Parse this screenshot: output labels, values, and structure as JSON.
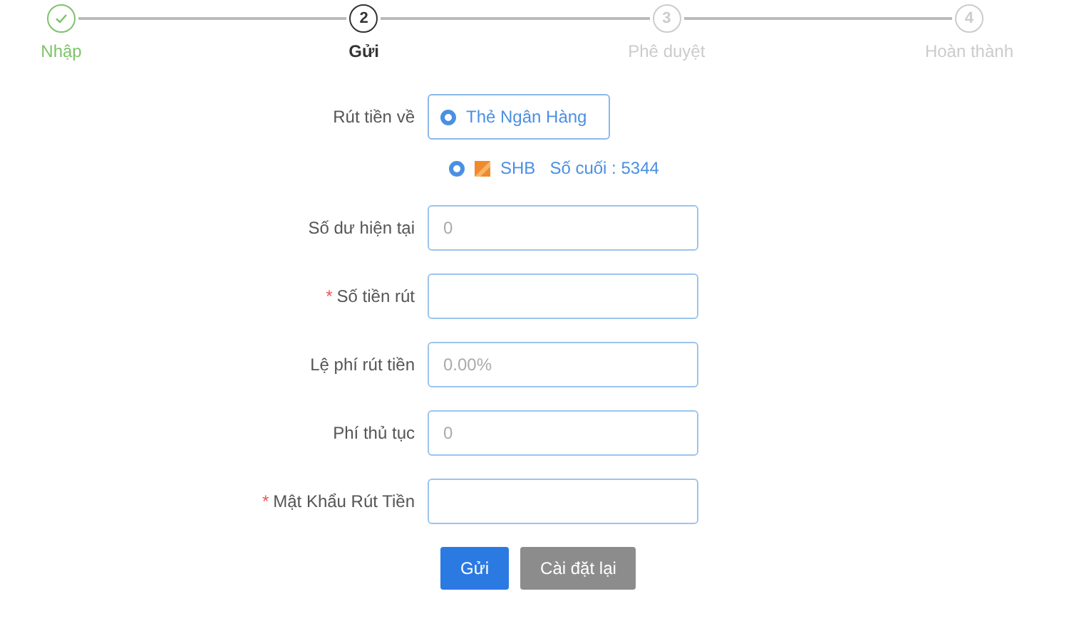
{
  "steps": [
    {
      "label": "Nhập",
      "completed": true,
      "selected": false
    },
    {
      "number": "2",
      "label": "Gửi",
      "completed": false,
      "selected": true
    },
    {
      "number": "3",
      "label": "Phê duyệt",
      "completed": false,
      "selected": false
    },
    {
      "number": "4",
      "label": "Hoàn thành",
      "completed": false,
      "selected": false
    }
  ],
  "withdraw_to": {
    "label": "Rút tiền về",
    "options": [
      {
        "label": "Thẻ Ngân Hàng",
        "selected": true
      }
    ]
  },
  "account": {
    "selected": true,
    "bank": "SHB",
    "last_digits": "Số cuối : 5344"
  },
  "fields": [
    {
      "label": "Số dư hiện tại",
      "required": false,
      "placeholder": "0"
    },
    {
      "label": "Số tiền rút",
      "required": true
    },
    {
      "label": "Lệ phí rút tiền",
      "required": false,
      "placeholder": "0.00%"
    },
    {
      "label": "Phí thủ tục",
      "required": false,
      "placeholder": "0"
    },
    {
      "label": "Mật Khẩu Rút Tiền",
      "required": true
    }
  ],
  "required_mark": "*",
  "buttons": [
    {
      "label": "Gửi",
      "kind": "primary"
    },
    {
      "label": "Cài đặt lại",
      "kind": "secondary"
    }
  ]
}
